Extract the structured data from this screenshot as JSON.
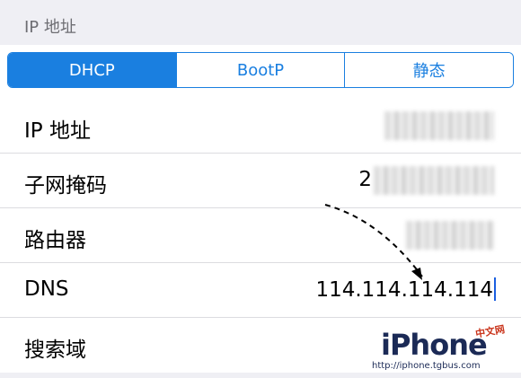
{
  "section": {
    "title": "IP 地址"
  },
  "segments": [
    {
      "label": "DHCP",
      "active": true
    },
    {
      "label": "BootP",
      "active": false
    },
    {
      "label": "静态",
      "active": false
    }
  ],
  "rows": [
    {
      "label": "IP 地址",
      "value": "",
      "blurred": true
    },
    {
      "label": "子网掩码",
      "value": "2",
      "blurred": true
    },
    {
      "label": "路由器",
      "value": "",
      "blurred": true
    },
    {
      "label": "DNS",
      "value": "114.114.114.114",
      "blurred": false
    },
    {
      "label": "搜索域",
      "value": "",
      "blurred": false
    }
  ],
  "watermark": {
    "brand": "iPhone",
    "cn": "中文网",
    "url": "http://iphone.tgbus.com"
  },
  "colors": {
    "accent": "#1a7fe0",
    "background": "#efeff4"
  }
}
